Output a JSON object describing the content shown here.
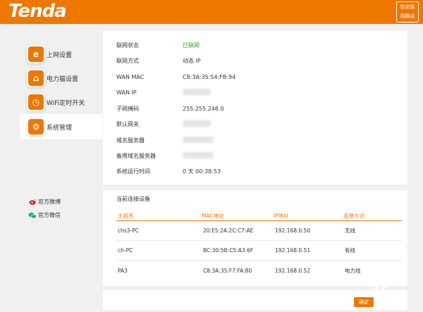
{
  "header": {
    "logo": "Tenda",
    "badge_line1": "恰安装",
    "badge_line2": "用腾达",
    "brand_color": "#ee7700"
  },
  "sidebar": {
    "items": [
      {
        "label": "上网设置",
        "icon": "internet-icon"
      },
      {
        "label": "电力猫设置",
        "icon": "powerline-icon"
      },
      {
        "label": "WiFi定时开关",
        "icon": "timer-icon"
      },
      {
        "label": "系统管理",
        "icon": "settings-icon",
        "active": true
      }
    ],
    "social": [
      {
        "label": "官方微博",
        "icon": "weibo-icon"
      },
      {
        "label": "官方微信",
        "icon": "wechat-icon"
      }
    ]
  },
  "status": {
    "rows": [
      {
        "key": "联网状态",
        "value": "已联网"
      },
      {
        "key": "联网方式",
        "value": "动态 IP"
      },
      {
        "key": "WAN MAC",
        "value": "C8:3A:35:54:FB:94"
      },
      {
        "key": "WAN IP",
        "value": ""
      },
      {
        "key": "子网掩码",
        "value": "255.255.248.0"
      },
      {
        "key": "默认网关",
        "value": ""
      },
      {
        "key": "域名服务器",
        "value": ""
      },
      {
        "key": "备用域名服务器",
        "value": ""
      },
      {
        "key": "系统运行时间",
        "value": "0 天 00:38:53"
      }
    ]
  },
  "devices": {
    "title": "当前连接设备",
    "columns": [
      "主机名",
      "MAC地址",
      "IP地址",
      "连接方式"
    ],
    "rows": [
      {
        "host": "chs3-PC",
        "mac": "20:E5:2A:2C:C7:AE",
        "ip": "192.168.0.50",
        "type": "无线"
      },
      {
        "host": "ch-PC",
        "mac": "BC:30:5B:C5:A3:6F",
        "ip": "192.168.0.51",
        "type": "有线"
      },
      {
        "host": "PA3",
        "mac": "C8:3A:35:F7:FA:80",
        "ip": "192.168.0.52",
        "type": "电力线"
      }
    ]
  },
  "footer": {
    "button_label": "确定"
  }
}
